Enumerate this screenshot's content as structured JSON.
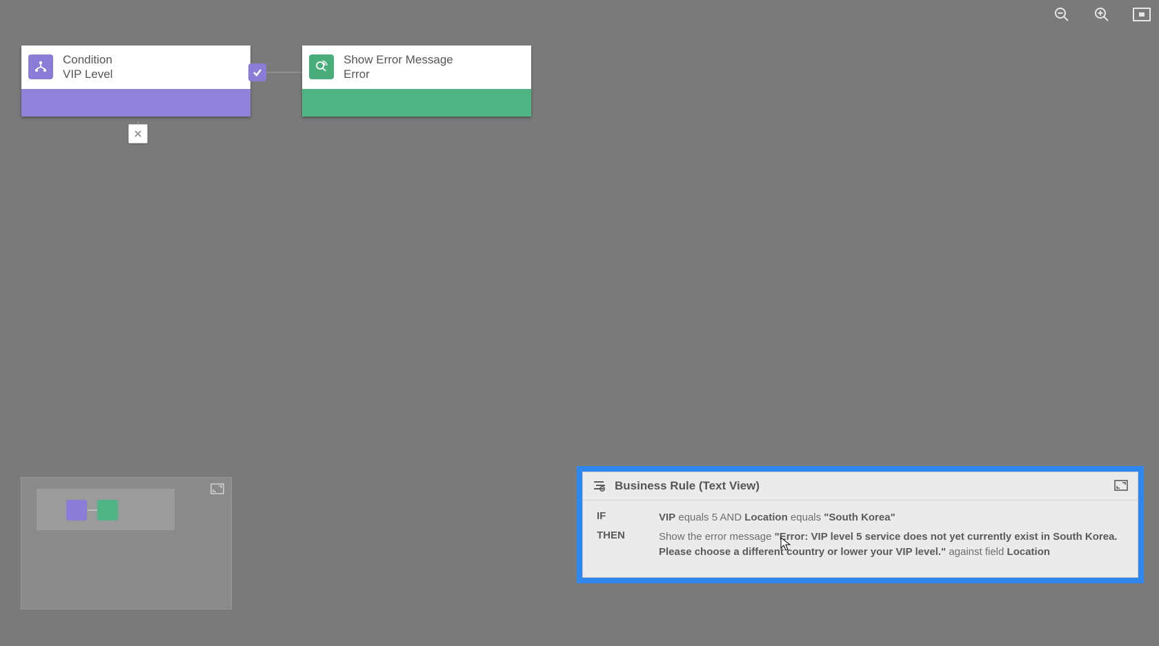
{
  "toolbar": {
    "zoom_out": "Zoom out",
    "zoom_in": "Zoom in",
    "fit": "Fit to screen"
  },
  "nodes": {
    "condition": {
      "line1": "Condition",
      "line2": "VIP Level"
    },
    "action": {
      "line1": "Show Error Message",
      "line2": "Error"
    }
  },
  "textview": {
    "title": "Business Rule (Text View)",
    "if_label": "IF",
    "then_label": "THEN",
    "if_parts": {
      "f1": "VIP",
      "op1": " equals 5 AND ",
      "f2": "Location",
      "op2": " equals ",
      "val": "\"South Korea\""
    },
    "then_parts": {
      "pre": "Show the error message ",
      "msg": "\"Error: VIP level 5 service does not yet currently exist in South Korea. Please choose a different country or lower your VIP level.\"",
      "mid": " against field ",
      "field": "Location"
    }
  }
}
